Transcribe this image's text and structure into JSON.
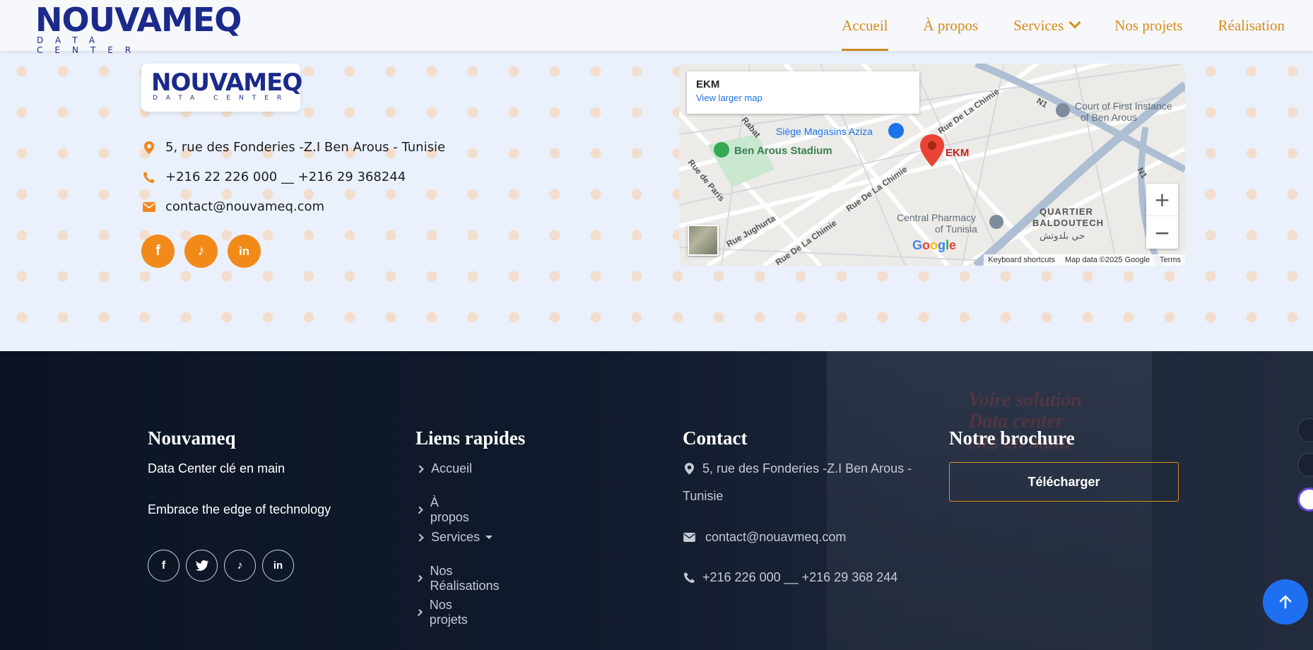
{
  "brand": {
    "name": "NOUVAMEQ",
    "tagline": "DATA CENTER"
  },
  "nav": {
    "items": [
      {
        "label": "Accueil",
        "active": true
      },
      {
        "label": "À propos"
      },
      {
        "label": "Services"
      },
      {
        "label": "Nos projets"
      },
      {
        "label": "Réalisation"
      }
    ]
  },
  "contact_info": {
    "address": "5, rue des Fonderies -Z.I Ben Arous - Tunisie",
    "phone": "+216 22 226 000 __ +216 29 368244",
    "email": "contact@nouvameq.com",
    "social": [
      "facebook-icon",
      "tiktok-icon",
      "linkedin-icon"
    ]
  },
  "map": {
    "place_name": "EKM",
    "larger_map_link": "View larger map",
    "labels": {
      "store": "Siège Magasins Aziza",
      "stadium": "Ben Arous Stadium",
      "pin": "EKM",
      "court": "Court of First Instance of Ben Arous",
      "court_line1": "Court of First Instance",
      "court_line2": "of Ben Arous",
      "pharmacy_line1": "Central Pharmacy",
      "pharmacy_line2": "of Tunisia",
      "quarter_line1": "QUARTIER",
      "quarter_line2": "BALDOUTECH",
      "quarter_ar": "حي بلدوتش",
      "road_chimie1": "Rue De La Chimie",
      "road_chimie2": "Rue De La Chimie",
      "road_chimie3": "Rue De La Chimie",
      "road_jughurta": "Rue Jughurta",
      "road_paris": "Rue de Paris",
      "road_rabat": "Rabat",
      "road_n1a": "N1",
      "road_n1b": "N1"
    },
    "google_logo": "Google",
    "footer": {
      "shortcuts": "Keyboard shortcuts",
      "data": "Map data ©2025 Google",
      "terms": "Terms"
    },
    "zoom_in": "+",
    "zoom_out": "−"
  },
  "footer": {
    "about": {
      "title": "Nouvameq",
      "line1": "Data Center clé en main",
      "line2": "Embrace the edge of technology",
      "social": [
        "facebook-icon",
        "twitter-icon",
        "tiktok-icon",
        "linkedin-icon"
      ]
    },
    "links": {
      "title": "Liens rapides",
      "items": [
        "Accueil",
        "À propos",
        "Services",
        "Nos Réalisations",
        "Nos projets"
      ]
    },
    "contact": {
      "title": "Contact",
      "address_line1": "5, rue des Fonderies -Z.I Ben Arous -",
      "address_line2": "Tunisie",
      "email": "contact@nouavmeq.com",
      "phone": "+216 226 000 __ +216 29 368 244"
    },
    "brochure": {
      "title": "Notre brochure",
      "button": "Télécharger"
    },
    "background_text": [
      "Voire solution",
      "Data center",
      "clés en main"
    ]
  },
  "colors": {
    "accent": "#f28a1a",
    "nav": "#d98c1a",
    "footer_bg": "#0c1424",
    "to_top": "#1f6ff2"
  }
}
